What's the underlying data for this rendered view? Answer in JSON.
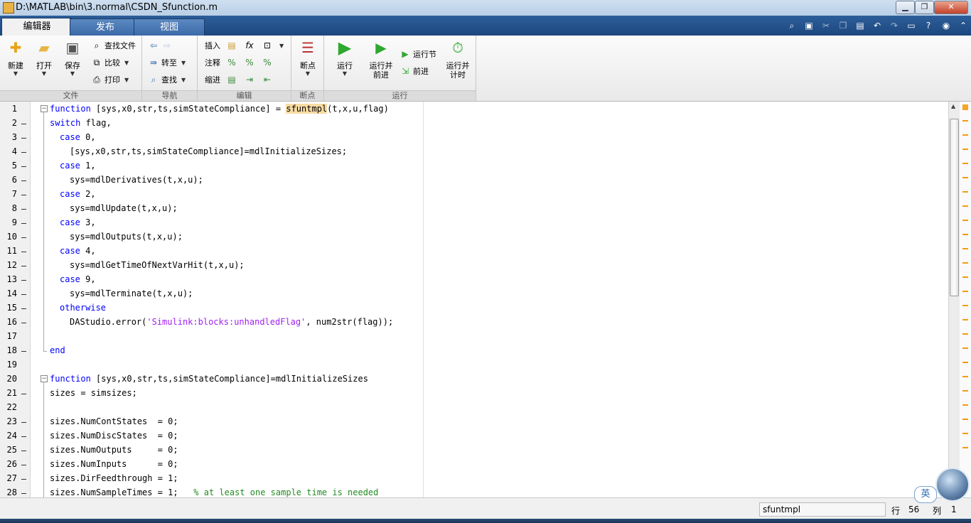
{
  "window": {
    "title": "D:\\MATLAB\\bin\\3.normal\\CSDN_Sfunction.m",
    "controls": [
      "▁",
      "❐",
      "✕"
    ]
  },
  "tabs": [
    {
      "label": "编辑器"
    },
    {
      "label": "发布"
    },
    {
      "label": "视图"
    }
  ],
  "ribbon": {
    "groups": {
      "file": "文件",
      "navigate": "导航",
      "edit": "编辑",
      "breakpoints": "断点",
      "run": "运行"
    },
    "buttons": {
      "new": "新建",
      "open": "打开",
      "save": "保存",
      "find_files": "查找文件",
      "compare": "比较",
      "print": "打印",
      "goto": "转至",
      "find": "查找",
      "insert": "插入",
      "comment": "注释",
      "indent": "缩进",
      "breakpoints": "断点",
      "run": "运行",
      "run_advance": "运行并\n前进",
      "run_section": "运行节",
      "advance": "前进",
      "run_time": "运行并\n计时"
    }
  },
  "editor": {
    "lines": [
      {
        "n": "1",
        "dash": false
      },
      {
        "n": "2",
        "dash": true
      },
      {
        "n": "3",
        "dash": true
      },
      {
        "n": "4",
        "dash": true
      },
      {
        "n": "5",
        "dash": true
      },
      {
        "n": "6",
        "dash": true
      },
      {
        "n": "7",
        "dash": true
      },
      {
        "n": "8",
        "dash": true
      },
      {
        "n": "9",
        "dash": true
      },
      {
        "n": "10",
        "dash": true
      },
      {
        "n": "11",
        "dash": true
      },
      {
        "n": "12",
        "dash": true
      },
      {
        "n": "13",
        "dash": true
      },
      {
        "n": "14",
        "dash": true
      },
      {
        "n": "15",
        "dash": true
      },
      {
        "n": "16",
        "dash": true
      },
      {
        "n": "17",
        "dash": false
      },
      {
        "n": "18",
        "dash": true
      },
      {
        "n": "19",
        "dash": false
      },
      {
        "n": "20",
        "dash": false
      },
      {
        "n": "21",
        "dash": true
      },
      {
        "n": "22",
        "dash": false
      },
      {
        "n": "23",
        "dash": true
      },
      {
        "n": "24",
        "dash": true
      },
      {
        "n": "25",
        "dash": true
      },
      {
        "n": "26",
        "dash": true
      },
      {
        "n": "27",
        "dash": true
      },
      {
        "n": "28",
        "dash": true
      }
    ],
    "code": {
      "l1_kw": "function",
      "l1_a": " [sys,x0,str,ts,simStateCompliance] = ",
      "l1_hl": "sfuntmpl",
      "l1_b": "(t,x,u,flag)",
      "l2_kw": "switch",
      "l2_a": " flag,",
      "l3_kw": "case",
      "l3_a": " 0,",
      "l4": "[sys,x0,str,ts,simStateCompliance]=mdlInitializeSizes;",
      "l5_kw": "case",
      "l5_a": " 1,",
      "l6": "sys=mdlDerivatives(t,x,u);",
      "l7_kw": "case",
      "l7_a": " 2,",
      "l8": "sys=mdlUpdate(t,x,u);",
      "l9_kw": "case",
      "l9_a": " 3,",
      "l10": "sys=mdlOutputs(t,x,u);",
      "l11_kw": "case",
      "l11_a": " 4,",
      "l12": "sys=mdlGetTimeOfNextVarHit(t,x,u);",
      "l13_kw": "case",
      "l13_a": " 9,",
      "l14": "sys=mdlTerminate(t,x,u);",
      "l15_kw": "otherwise",
      "l16_a": "DAStudio.error(",
      "l16_str": "'Simulink:blocks:unhandledFlag'",
      "l16_b": ", num2str(flag));",
      "l18_kw": "end",
      "l20_kw": "function",
      "l20_a": " [sys,x0,str,ts,simStateCompliance]=mdlInitializeSizes",
      "l21": "sizes = simsizes;",
      "l23": "sizes.NumContStates  = 0;",
      "l24": "sizes.NumDiscStates  = 0;",
      "l25": "sizes.NumOutputs     = 0;",
      "l26": "sizes.NumInputs      = 0;",
      "l27": "sizes.DirFeedthrough = 1;",
      "l28_a": "sizes.NumSampleTimes = 1;   ",
      "l28_cmt": "% at least one sample time is needed"
    }
  },
  "status": {
    "function_name": "sfuntmpl",
    "row_label": "行",
    "row": "56",
    "col_label": "列",
    "col": "1",
    "ime": "英"
  },
  "colors": {
    "keyword": "#0000ff",
    "string": "#a020f0",
    "comment": "#228b22",
    "highlight": "#f7dba3",
    "tabbar": "#1c477e"
  }
}
